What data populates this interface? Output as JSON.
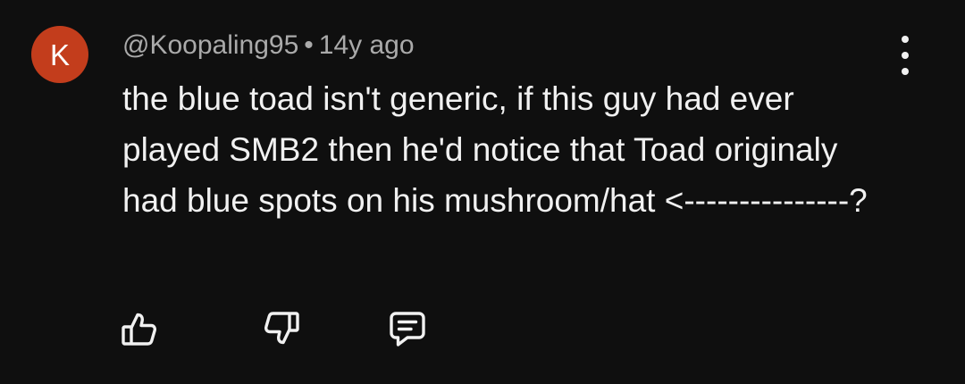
{
  "comment": {
    "avatar_letter": "K",
    "avatar_color": "#c33d1c",
    "author": "@Koopaling95",
    "separator": "•",
    "age": "14y ago",
    "text_lines": [
      "the blue toad isn't generic, if this guy had ever",
      "played SMB2 then he'd notice that Toad originaly",
      "had blue spots on his mushroom/hat <---------------?"
    ]
  },
  "actions": {
    "like_icon": "thumbs-up-icon",
    "dislike_icon": "thumbs-down-icon",
    "reply_icon": "reply-comment-icon",
    "menu_icon": "more-vertical-icon"
  }
}
